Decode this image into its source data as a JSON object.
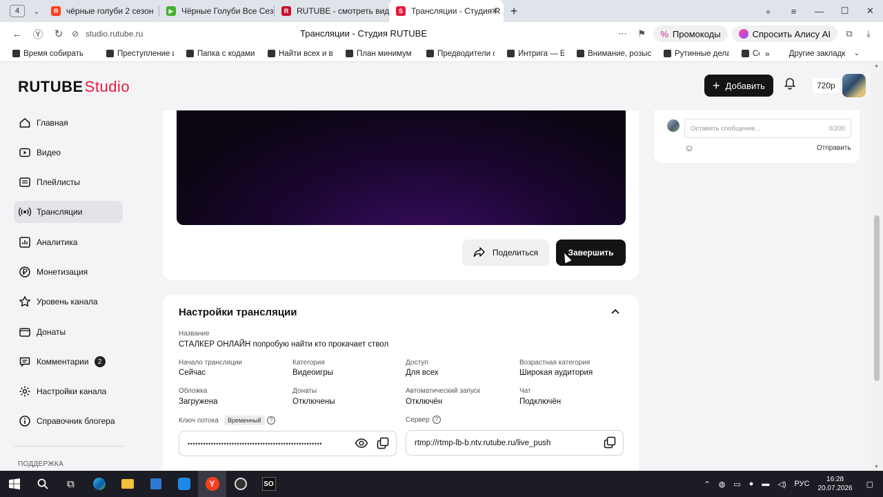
{
  "browser": {
    "tab_count": "4",
    "tabs": [
      {
        "label": "чёрные голуби 2 сезон"
      },
      {
        "label": "Чёрные Голуби Все Сезо"
      },
      {
        "label": "RUTUBE - смотреть виде"
      },
      {
        "label": "Трансляции - Студия R"
      }
    ],
    "url_host": "studio.rutube.ru",
    "page_title": "Трансляции - Студия RUTUBE",
    "promo_label": "Промокоды",
    "alice_label": "Спросить Алису AI",
    "bookmarks": [
      "Время собирать",
      "Преступление и",
      "Папка с кодами –",
      "Найти всех и выр",
      "План минимум –",
      "Предводители ор",
      "Интрига — База",
      "Внимание, розыс",
      "Рутинные дела –",
      "Се"
    ],
    "other_bookmarks": "Другие закладки"
  },
  "header": {
    "logo_main": "RUTUBE",
    "logo_studio": "Studio",
    "add_label": "Добавить",
    "quality": "720p"
  },
  "sidebar": {
    "items": [
      {
        "label": "Главная",
        "icon": "home-icon"
      },
      {
        "label": "Видео",
        "icon": "video-icon"
      },
      {
        "label": "Плейлисты",
        "icon": "playlist-icon"
      },
      {
        "label": "Трансляции",
        "icon": "broadcast-icon"
      },
      {
        "label": "Аналитика",
        "icon": "analytics-icon"
      },
      {
        "label": "Монетизация",
        "icon": "monetization-icon"
      },
      {
        "label": "Уровень канала",
        "icon": "star-icon"
      },
      {
        "label": "Донаты",
        "icon": "donate-icon"
      },
      {
        "label": "Комментарии",
        "icon": "comments-icon",
        "badge": "2"
      },
      {
        "label": "Настройки канала",
        "icon": "gear-icon"
      },
      {
        "label": "Справочник блогера",
        "icon": "info-icon"
      }
    ],
    "support_label": "ПОДДЕРЖКА"
  },
  "player": {
    "share_label": "Поделиться",
    "finish_label": "Завершить"
  },
  "settings": {
    "title": "Настройки трансляции",
    "name_label": "Название",
    "name_value": "СТАЛКЕР ОНЛАЙН попробую найти кто прокачает ствол",
    "fields": {
      "start_label": "Начало трансляции",
      "start_value": "Сейчас",
      "category_label": "Категория",
      "category_value": "Видеоигры",
      "access_label": "Доступ",
      "access_value": "Для всех",
      "age_label": "Возрастная категория",
      "age_value": "Широкая аудитория",
      "cover_label": "Обложка",
      "cover_value": "Загружена",
      "donate_label": "Донаты",
      "donate_value": "Отключены",
      "autostart_label": "Автоматический запуск",
      "autostart_value": "Отключён",
      "chat_label": "Чат",
      "chat_value": "Подключён"
    },
    "stream_key_label": "Ключ потока",
    "stream_key_badge": "Временный",
    "stream_key_value": "••••••••••••••••••••••••••••••••••••••••••••••••••••",
    "server_label": "Сервер",
    "server_value": "rtmp://rtmp-lb-b.ntv.rutube.ru/live_push"
  },
  "chat": {
    "placeholder": "Оставить сообщение...",
    "counter": "0/200",
    "send_label": "Отправить"
  },
  "taskbar": {
    "lang": "РУС",
    "time": "16:28",
    "date": "20.07.2026"
  },
  "colors": {
    "accent": "#e8193c",
    "dark_button": "#141414"
  }
}
